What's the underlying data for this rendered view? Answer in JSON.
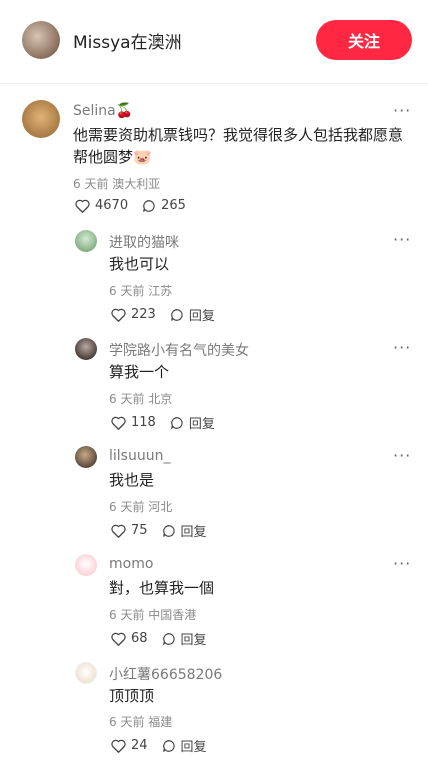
{
  "header": {
    "author": "Missya在澳洲",
    "follow_label": "关注"
  },
  "main_comment": {
    "user": "Selina",
    "user_emoji": "🍒",
    "text": "他需要资助机票钱吗？我觉得很多人包括我都愿意帮他圆梦",
    "text_emoji": "🐷",
    "time": "6 天前",
    "location": "澳大利亚",
    "likes": "4670",
    "replies": "265"
  },
  "replies": [
    {
      "user": "进取的猫咪",
      "text": "我也可以",
      "time": "6 天前",
      "location": "江苏",
      "likes": "223",
      "reply_label": "回复",
      "avatar_color": "#9fc6a0"
    },
    {
      "user": "学院路小有名气的美女",
      "text": "算我一个",
      "time": "6 天前",
      "location": "北京",
      "likes": "118",
      "reply_label": "回复",
      "avatar_color": "#4a3f3a"
    },
    {
      "user": "lilsuuun_",
      "text": "我也是",
      "time": "6 天前",
      "location": "河北",
      "likes": "75",
      "reply_label": "回复",
      "avatar_color": "#5a4a3a"
    },
    {
      "user": "momo",
      "text": "對，也算我一個",
      "time": "6 天前",
      "location": "中国香港",
      "likes": "68",
      "reply_label": "回复",
      "avatar_color": "#fbd3d8"
    },
    {
      "user": "小红薯66658206",
      "text": "顶顶顶",
      "time": "6 天前",
      "location": "福建",
      "likes": "24",
      "reply_label": "回复",
      "avatar_color": "#f3ece2"
    }
  ]
}
